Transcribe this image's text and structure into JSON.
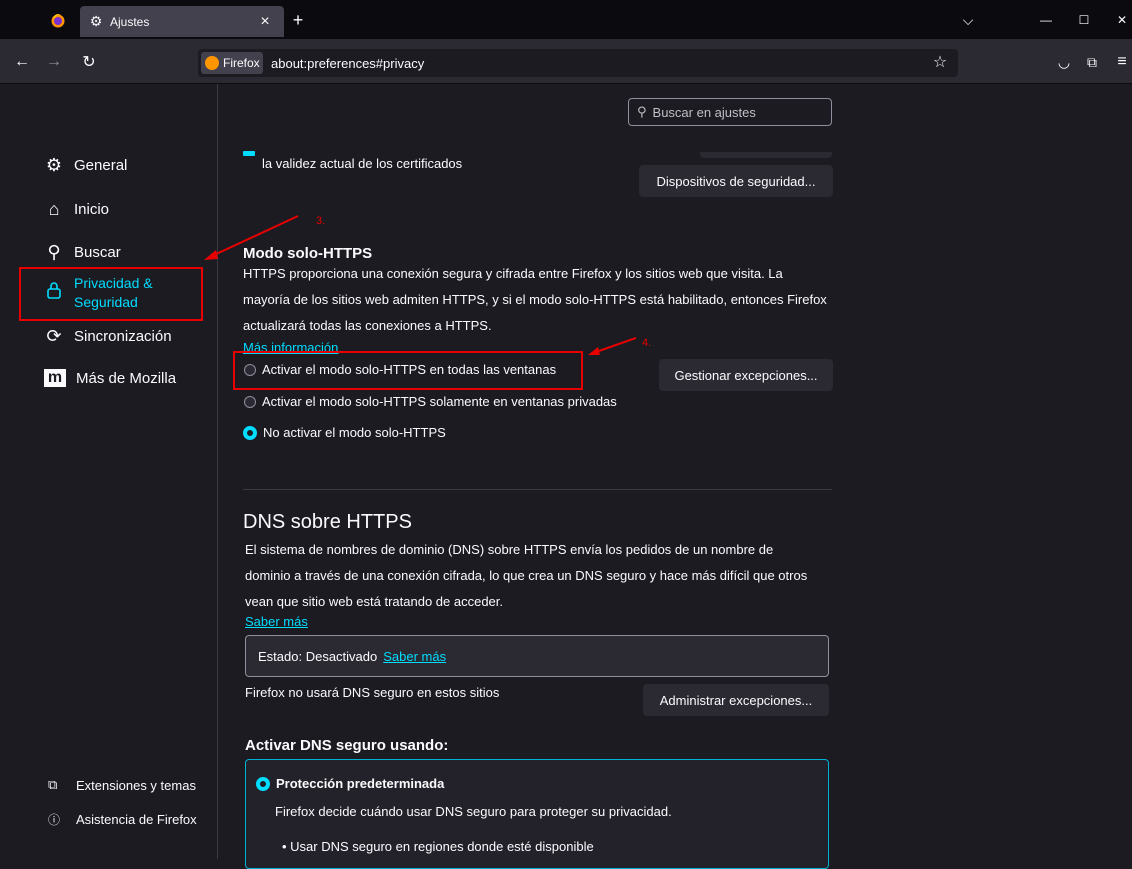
{
  "tab": {
    "title": "Ajustes",
    "close": "×",
    "new": "+"
  },
  "window": {
    "list": "⌵",
    "minimize": "—",
    "maximize": "☐",
    "close": "✕"
  },
  "url": {
    "identity": "Firefox",
    "address": "about:preferences#privacy"
  },
  "search": {
    "placeholder": "Buscar en ajustes"
  },
  "sidebar": {
    "items": [
      {
        "label": "General"
      },
      {
        "label": "Inicio"
      },
      {
        "label": "Buscar"
      },
      {
        "label": "Privacidad & Seguridad",
        "line1": "Privacidad &",
        "line2": "Seguridad"
      },
      {
        "label": "Sincronización"
      },
      {
        "label": "Más de Mozilla",
        "logo": "m"
      }
    ],
    "footer": [
      {
        "label": "Extensiones y temas"
      },
      {
        "label": "Asistencia de Firefox"
      }
    ]
  },
  "certs": {
    "text": "la validez actual de los certificados",
    "devices_button": "Dispositivos de seguridad..."
  },
  "https_only": {
    "title": "Modo solo-HTTPS",
    "line1": "HTTPS proporciona una conexión segura y cifrada entre Firefox y los sitios web que visita. La",
    "line2": "mayoría de los sitios web admiten HTTPS, y si el modo solo-HTTPS está habilitado, entonces Firefox",
    "line3": "actualizará todas las conexiones a HTTPS.",
    "learn_more": "Más información",
    "options": [
      "Activar el modo solo-HTTPS en todas las ventanas",
      "Activar el modo solo-HTTPS solamente en ventanas privadas",
      "No activar el modo solo-HTTPS"
    ],
    "selected": 2,
    "exceptions_button": "Gestionar excepciones..."
  },
  "dns": {
    "title": "DNS sobre HTTPS",
    "line1": "El sistema de nombres de dominio (DNS) sobre HTTPS envía los pedidos de un nombre de",
    "line2": "dominio a través de una conexión cifrada, lo que crea un DNS seguro y hace más difícil que otros",
    "line3": "vean que sitio web está tratando de acceder.",
    "learn_more": "Saber más",
    "status_label": "Estado: Desactivado",
    "status_link": "Saber más",
    "no_secure": "Firefox no usará DNS seguro en estos sitios",
    "exceptions_button": "Administrar excepciones...",
    "enable_title": "Activar DNS seguro usando:",
    "default_title": "Protección predeterminada",
    "default_desc": "Firefox decide cuándo usar DNS seguro para proteger su privacidad.",
    "bullet1": "• Usar DNS seguro en regiones donde esté disponible"
  },
  "annotations": {
    "step3": "3.",
    "step4": "4."
  },
  "colors": {
    "accent": "#00ddff",
    "annotation": "#e80000",
    "background": "#1c1b22"
  }
}
